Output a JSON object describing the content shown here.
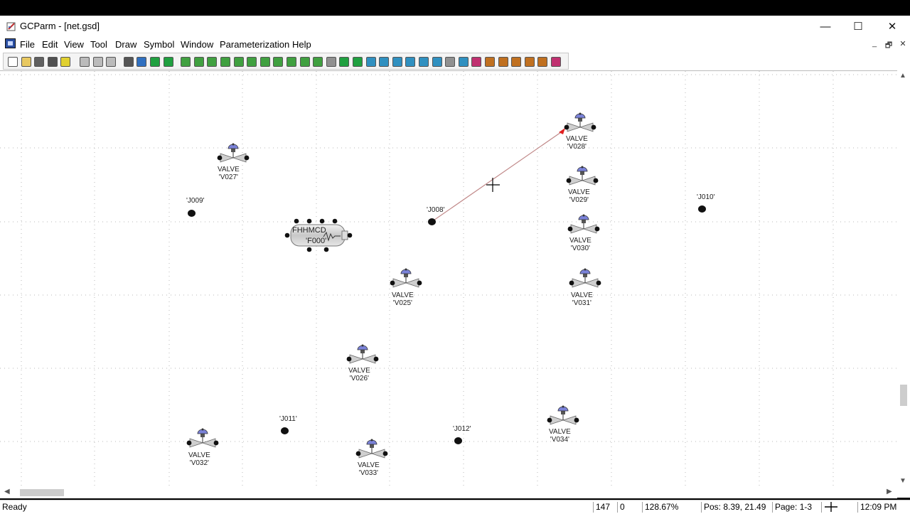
{
  "window": {
    "title": "GCParm - [net.gsd]",
    "minimize": "—",
    "maximize": "☐",
    "close": "✕"
  },
  "menu": {
    "items": [
      "File",
      "Edit",
      "View",
      "Tool",
      "Draw",
      "Symbol",
      "Window",
      "Parameterization",
      "Help"
    ],
    "mdi_min": "_",
    "mdi_restore": "🗗",
    "mdi_close": "✕"
  },
  "toolbar": {
    "icons": [
      "new-icon",
      "open-icon",
      "save-icon",
      "print-icon",
      "help-icon",
      "cut-icon",
      "copy-icon",
      "paste-icon",
      "select-icon",
      "zoom-icon",
      "zoom-fit-icon",
      "pan-icon",
      "tool-a-icon",
      "tool-b-icon",
      "tool-c-icon",
      "tool-d-icon",
      "tool-e-icon",
      "tool-f-icon",
      "tool-g-icon",
      "tool-h-icon",
      "tool-i-icon",
      "tool-j-icon",
      "tool-k-icon",
      "tool-l-icon",
      "tool-m-icon",
      "tool-n-icon",
      "tool-o-icon",
      "tool-p-icon",
      "tool-q-icon",
      "tool-r-icon",
      "tool-s-icon",
      "tool-t-icon",
      "tool-u-icon",
      "tool-v-icon",
      "tool-w-icon",
      "tool-x-icon",
      "tool-y-icon",
      "tool-z-icon",
      "tool-aa-icon",
      "tool-ab-icon",
      "tool-ac-icon"
    ],
    "colors": [
      "#ffffff",
      "#e8c860",
      "#606060",
      "#505050",
      "#e0d030",
      "#bbbbbb",
      "#bbbbbb",
      "#bbbbbb",
      "#555555",
      "#3070c0",
      "#20a040",
      "#20a040",
      "#40a040",
      "#40a040",
      "#40a040",
      "#40a040",
      "#40a040",
      "#40a040",
      "#40a040",
      "#40a040",
      "#40a040",
      "#40a040",
      "#40a040",
      "#909090",
      "#20a040",
      "#20a040",
      "#3090c0",
      "#3090c0",
      "#3090c0",
      "#3090c0",
      "#3090c0",
      "#3090c0",
      "#909090",
      "#3090c0",
      "#c03070",
      "#c07020",
      "#c07020",
      "#c07020",
      "#c07020",
      "#c07020",
      "#c03070"
    ]
  },
  "canvas": {
    "valves": [
      {
        "type": "VALVE",
        "id": "'V027'"
      },
      {
        "type": "VALVE",
        "id": "'V028'"
      },
      {
        "type": "VALVE",
        "id": "'V029'"
      },
      {
        "type": "VALVE",
        "id": "'V030'"
      },
      {
        "type": "VALVE",
        "id": "'V025'"
      },
      {
        "type": "VALVE",
        "id": "'V031'"
      },
      {
        "type": "VALVE",
        "id": "'V026'"
      },
      {
        "type": "VALVE",
        "id": "'V034'"
      },
      {
        "type": "VALVE",
        "id": "'V032'"
      },
      {
        "type": "VALVE",
        "id": "'V033'"
      }
    ],
    "junctions": [
      "'J009'",
      "'J008'",
      "'J010'",
      "'J011'",
      "'J012'"
    ],
    "filter": {
      "type": "FHHMCD",
      "id": "'F000'"
    }
  },
  "status": {
    "ready": "Ready",
    "x": "147",
    "y": "0",
    "zoom": "128.67%",
    "pos": "Pos: 8.39, 21.49",
    "page": "Page: 1-3",
    "time": "12:09 PM"
  },
  "colors": {
    "valve_bonnet": "#7a82d8",
    "link_line": "#c08888",
    "link_end": "#e02020"
  }
}
